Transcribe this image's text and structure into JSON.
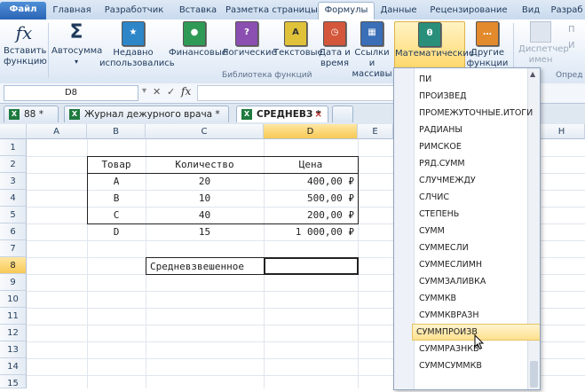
{
  "tabs": [
    "Файл",
    "Главная",
    "Разработчик",
    "Вставка",
    "Разметка страницы",
    "Формулы",
    "Данные",
    "Рецензирование",
    "Вид",
    "Разраб"
  ],
  "ribbon": {
    "insert_fn": [
      "Вставить",
      "функцию"
    ],
    "autosum": "Автосумма",
    "recent": [
      "Недавно",
      "использовались"
    ],
    "financial": "Финансовые",
    "logical": "Логические",
    "text": "Текстовые",
    "datetime": [
      "Дата и",
      "время"
    ],
    "lookup": [
      "Ссылки и",
      "массивы"
    ],
    "math": "Математические",
    "other": [
      "Другие",
      "функции"
    ],
    "names": [
      "Диспетчер",
      "имен"
    ],
    "group_label": "Библиотека функций",
    "right_group": "Опред",
    "right_p": "П",
    "right_i": "И"
  },
  "formula_bar": {
    "name_box": "D8",
    "cancel": "✕",
    "enter": "✓",
    "fx": "fx"
  },
  "doc_tabs": [
    {
      "label": "88 *",
      "close": "×"
    },
    {
      "label": "Журнал дежурного врача *",
      "close": "×"
    },
    {
      "label": "СРЕДНЕВЗ *",
      "close": "×"
    }
  ],
  "columns": [
    "A",
    "B",
    "C",
    "D",
    "E",
    "H"
  ],
  "rows": [
    "1",
    "2",
    "3",
    "4",
    "5",
    "6",
    "7",
    "8",
    "9",
    "10",
    "11",
    "12",
    "13",
    "14",
    "15"
  ],
  "table": {
    "headers": [
      "Товар",
      "Количество",
      "Цена"
    ],
    "rows": [
      [
        "A",
        "20",
        "400,00 ₽"
      ],
      [
        "B",
        "10",
        "500,00 ₽"
      ],
      [
        "C",
        "40",
        "200,00 ₽"
      ],
      [
        "D",
        "15",
        "1 000,00 ₽"
      ]
    ],
    "weighted_label": "Средневзвешенное"
  },
  "dropdown": {
    "items": [
      "ПИ",
      "ПРОИЗВЕД",
      "ПРОМЕЖУТОЧНЫЕ.ИТОГИ",
      "РАДИАНЫ",
      "РИМСКОЕ",
      "РЯД.СУММ",
      "СЛУЧМЕЖДУ",
      "СЛЧИС",
      "СТЕПЕНЬ",
      "СУММ",
      "СУММЕСЛИ",
      "СУММЕСЛИМН",
      "СУММЗАЛИВКА",
      "СУММКВ",
      "СУММКВРАЗН",
      "СУММПРОИЗВ",
      "СУММРАЗНКВ",
      "СУММСУММКВ"
    ],
    "selected": "СУММПРОИЗВ",
    "scroll_up": "▲"
  },
  "colors": {
    "accent": "#2a64b5",
    "highlight": "#ffe08e",
    "excel_green": "#1e7a3e"
  }
}
